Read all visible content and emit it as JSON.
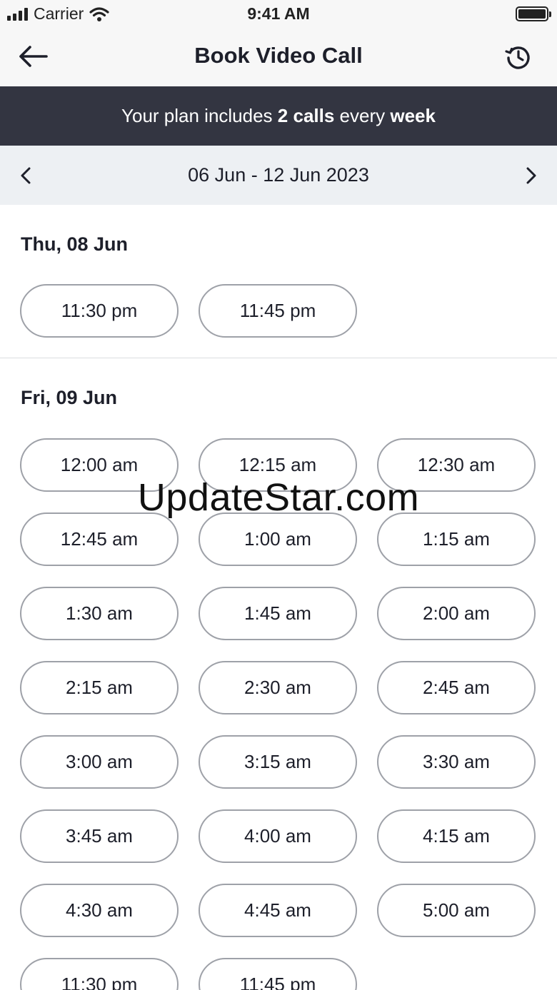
{
  "status_bar": {
    "carrier": "Carrier",
    "time": "9:41 AM"
  },
  "nav": {
    "title": "Book Video Call",
    "back_icon": "arrow-left-icon",
    "history_icon": "history-clock-icon"
  },
  "plan_banner": {
    "prefix": "Your plan includes ",
    "calls": "2 calls",
    "middle": " every ",
    "period": "week"
  },
  "week_selector": {
    "range": "06 Jun - 12 Jun 2023",
    "prev_icon": "chevron-left-icon",
    "next_icon": "chevron-right-icon"
  },
  "days": [
    {
      "label": "Thu, 08 Jun",
      "slots": [
        "11:30 pm",
        "11:45 pm"
      ]
    },
    {
      "label": "Fri, 09 Jun",
      "slots": [
        "12:00 am",
        "12:15 am",
        "12:30 am",
        "12:45 am",
        "1:00 am",
        "1:15 am",
        "1:30 am",
        "1:45 am",
        "2:00 am",
        "2:15 am",
        "2:30 am",
        "2:45 am",
        "3:00 am",
        "3:15 am",
        "3:30 am",
        "3:45 am",
        "4:00 am",
        "4:15 am",
        "4:30 am",
        "4:45 am",
        "5:00 am",
        "11:30 pm",
        "11:45 pm"
      ]
    }
  ],
  "watermark": "UpdateStar.com",
  "colors": {
    "banner_bg": "#333541",
    "week_bar_bg": "#edf0f3",
    "slot_border": "#9ea1a8",
    "text": "#1d1f2a"
  }
}
